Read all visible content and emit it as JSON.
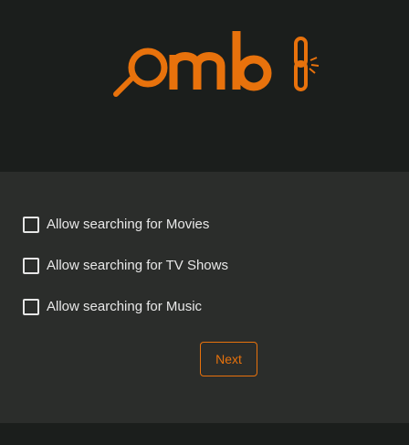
{
  "brand": {
    "logo_text": "omb",
    "accent_color": "#e8720c"
  },
  "options": [
    {
      "label": "Allow searching for Movies",
      "checked": false
    },
    {
      "label": "Allow searching for TV Shows",
      "checked": false
    },
    {
      "label": "Allow searching for Music",
      "checked": false
    }
  ],
  "actions": {
    "next_label": "Next"
  },
  "icons": [
    "magnifier-icon",
    "chain-link-icon",
    "checkbox-icon"
  ]
}
